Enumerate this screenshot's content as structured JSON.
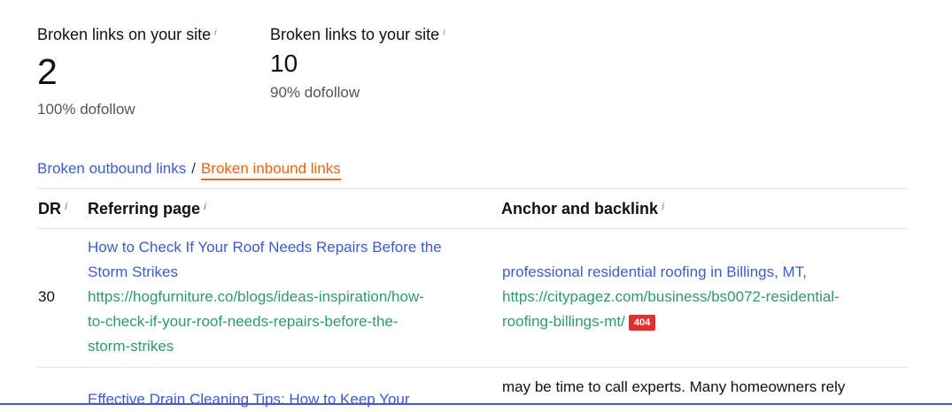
{
  "stats": {
    "onsite": {
      "label": "Broken links on your site",
      "value": "2",
      "sub": "100% dofollow"
    },
    "tosite": {
      "label": "Broken links to your site",
      "value": "10",
      "sub": "90% dofollow"
    },
    "info_glyph": "i"
  },
  "tabs": {
    "outbound": "Broken outbound links",
    "separator": "/",
    "inbound": "Broken inbound links"
  },
  "table": {
    "headers": {
      "dr": "DR",
      "referring": "Referring page",
      "anchor": "Anchor and backlink"
    },
    "rows": [
      {
        "dr": "30",
        "page_title_1": "How to Check If Your Roof Needs Repairs Before the",
        "page_title_2": "Storm Strikes",
        "page_url_1": "https://hogfurniture.co/blogs/ideas-inspiration/how-",
        "page_url_2": "to-check-if-your-roof-needs-repairs-before-the-",
        "page_url_3": "storm-strikes",
        "anchor_text": "professional residential roofing in Billings, MT,",
        "backlink_1": "https://citypagez.com/business/bs0072-residential-",
        "backlink_2": "roofing-billings-mt/",
        "status": "404"
      },
      {
        "page_title_1": "Effective Drain Cleaning Tips: How to Keep Your",
        "anchor_text": "may be time to call experts. Many homeowners rely"
      }
    ]
  },
  "colors": {
    "link_blue": "#3d5ccc",
    "url_green": "#2e9b64",
    "active_tab": "#e8650f",
    "badge_red": "#e03131"
  }
}
